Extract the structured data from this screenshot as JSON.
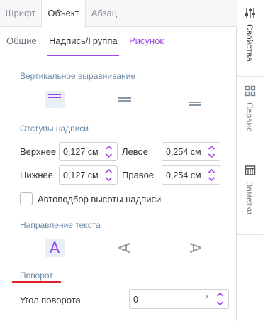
{
  "top_tabs": [
    "Шрифт",
    "Объект",
    "Абзац"
  ],
  "sub_tabs": [
    "Общие",
    "Надпись/Группа",
    "Рисунок"
  ],
  "vertical_alignment": {
    "label": "Вертикальное выравнивание",
    "selected": "top"
  },
  "margins": {
    "label": "Отступы надписи",
    "top": {
      "label": "Верхнее",
      "value": "0,127 см"
    },
    "left": {
      "label": "Левое",
      "value": "0,254 см"
    },
    "bottom": {
      "label": "Нижнее",
      "value": "0,127 см"
    },
    "right": {
      "label": "Правое",
      "value": "0,254 см"
    }
  },
  "autofit": {
    "label": "Автоподбор высоты надписи",
    "checked": false
  },
  "text_direction": {
    "label": "Направление текста",
    "glyph": "A",
    "selected": "horizontal"
  },
  "rotation": {
    "label": "Поворот",
    "angle_label": "Угол поворота",
    "angle_value": "0",
    "unit": "°"
  },
  "sidebar": [
    {
      "label": "Свойства",
      "icon": "sliders-icon",
      "active": true
    },
    {
      "label": "Сервис",
      "icon": "grid-icon",
      "active": false
    },
    {
      "label": "Заметки",
      "icon": "notes-icon",
      "active": false
    }
  ],
  "colors": {
    "accent": "#9b46e8",
    "section": "#6e8aa8",
    "highlight": "#e0232a"
  }
}
